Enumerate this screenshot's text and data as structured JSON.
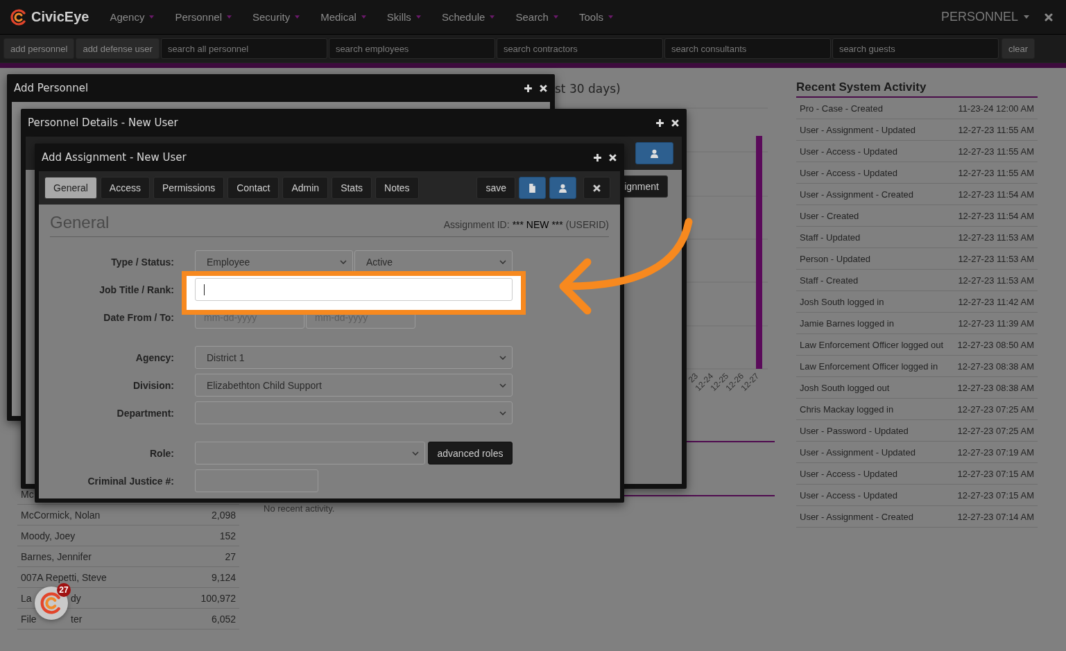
{
  "nav": {
    "brand": "CivicEye",
    "menus": [
      "Agency",
      "Personnel",
      "Security",
      "Medical",
      "Skills",
      "Schedule",
      "Search",
      "Tools"
    ],
    "module": "PERSONNEL"
  },
  "toolbar": {
    "buttons": [
      "add personnel",
      "add defense user"
    ],
    "searches": [
      {
        "placeholder": "search all personnel"
      },
      {
        "placeholder": "search employees"
      },
      {
        "placeholder": "search contractors"
      },
      {
        "placeholder": "search consultants"
      },
      {
        "placeholder": "search guests"
      }
    ],
    "clear": "clear"
  },
  "chart": {
    "heading": "st 30 days)",
    "x_labels": [
      "23",
      "12-24",
      "12-25",
      "12-26",
      "12-27"
    ]
  },
  "no_activity": "No recent activity.",
  "people": [
    {
      "name": "Mc"
    },
    {
      "name": "McCormick, Nolan",
      "value": "2,098"
    },
    {
      "name": "Moody, Joey",
      "value": "152"
    },
    {
      "name": "Barnes, Jennifer",
      "value": "27"
    },
    {
      "name": "007A Repetti, Steve",
      "value": "9,124"
    },
    {
      "name": "La",
      "name_end": "dy",
      "value": "100,972"
    },
    {
      "name": "File",
      "name_end": "ter",
      "value": "6,052"
    }
  ],
  "activity": {
    "title": "Recent System Activity",
    "items": [
      {
        "event": "Pro - Case - Created",
        "time": "11-23-24 12:00 AM"
      },
      {
        "event": "User - Assignment - Updated",
        "time": "12-27-23 11:55 AM"
      },
      {
        "event": "User - Access - Updated",
        "time": "12-27-23 11:55 AM"
      },
      {
        "event": "User - Access - Updated",
        "time": "12-27-23 11:55 AM"
      },
      {
        "event": "User - Assignment - Created",
        "time": "12-27-23 11:54 AM"
      },
      {
        "event": "User - Created",
        "time": "12-27-23 11:54 AM"
      },
      {
        "event": "Staff - Updated",
        "time": "12-27-23 11:53 AM"
      },
      {
        "event": "Person - Updated",
        "time": "12-27-23 11:53 AM"
      },
      {
        "event": "Staff - Created",
        "time": "12-27-23 11:53 AM"
      },
      {
        "event": "Josh South logged in",
        "time": "12-27-23 11:42 AM"
      },
      {
        "event": "Jamie Barnes logged in",
        "time": "12-27-23 11:39 AM"
      },
      {
        "event": "Law Enforcement Officer logged out",
        "time": "12-27-23 08:50 AM"
      },
      {
        "event": "Law Enforcement Officer logged in",
        "time": "12-27-23 08:38 AM"
      },
      {
        "event": "Josh South logged out",
        "time": "12-27-23 08:38 AM"
      },
      {
        "event": "Chris Mackay logged in",
        "time": "12-27-23 07:25 AM"
      },
      {
        "event": "User - Password - Updated",
        "time": "12-27-23 07:25 AM"
      },
      {
        "event": "User - Assignment - Updated",
        "time": "12-27-23 07:19 AM"
      },
      {
        "event": "User - Access - Updated",
        "time": "12-27-23 07:15 AM"
      },
      {
        "event": "User - Access - Updated",
        "time": "12-27-23 07:15 AM"
      },
      {
        "event": "User - Assignment - Created",
        "time": "12-27-23 07:14 AM"
      }
    ]
  },
  "windows": [
    {
      "title": "Add Personnel"
    },
    {
      "title": "Personnel Details - New User",
      "side_button": "ignment"
    },
    {
      "title": "Add Assignment - New User"
    }
  ],
  "assignment": {
    "tabs": [
      {
        "label": "General",
        "selected": true
      },
      {
        "label": "Access",
        "selected": false
      },
      {
        "label": "Permissions",
        "selected": false
      },
      {
        "label": "Contact",
        "selected": false
      },
      {
        "label": "Admin",
        "selected": false
      },
      {
        "label": "Stats",
        "selected": false
      },
      {
        "label": "Notes",
        "selected": false
      }
    ],
    "save": "save",
    "heading": "General",
    "id_label": "Assignment ID:",
    "id_value": "*** NEW ***",
    "id_suffix": "(USERID)",
    "groups": [
      [
        {
          "label": "Type / Status:",
          "kind": "select_pair",
          "values": [
            "Employee",
            "Active"
          ]
        },
        {
          "label": "Job Title / Rank:",
          "kind": "text",
          "focused": true,
          "highlighted": true
        },
        {
          "label": "Date From / To:",
          "kind": "date_pair",
          "placeholders": [
            "mm-dd-yyyy",
            "mm-dd-yyyy"
          ]
        }
      ],
      [
        {
          "label": "Agency:",
          "kind": "select",
          "value": "District 1"
        },
        {
          "label": "Division:",
          "kind": "select",
          "value": "Elizabethton Child Support"
        },
        {
          "label": "Department:",
          "kind": "select"
        }
      ],
      [
        {
          "label": "Role:",
          "kind": "select_button",
          "button": "advanced roles"
        },
        {
          "label": "Criminal Justice #:",
          "kind": "short_text"
        }
      ]
    ]
  },
  "launcher": {
    "badge": "27"
  }
}
